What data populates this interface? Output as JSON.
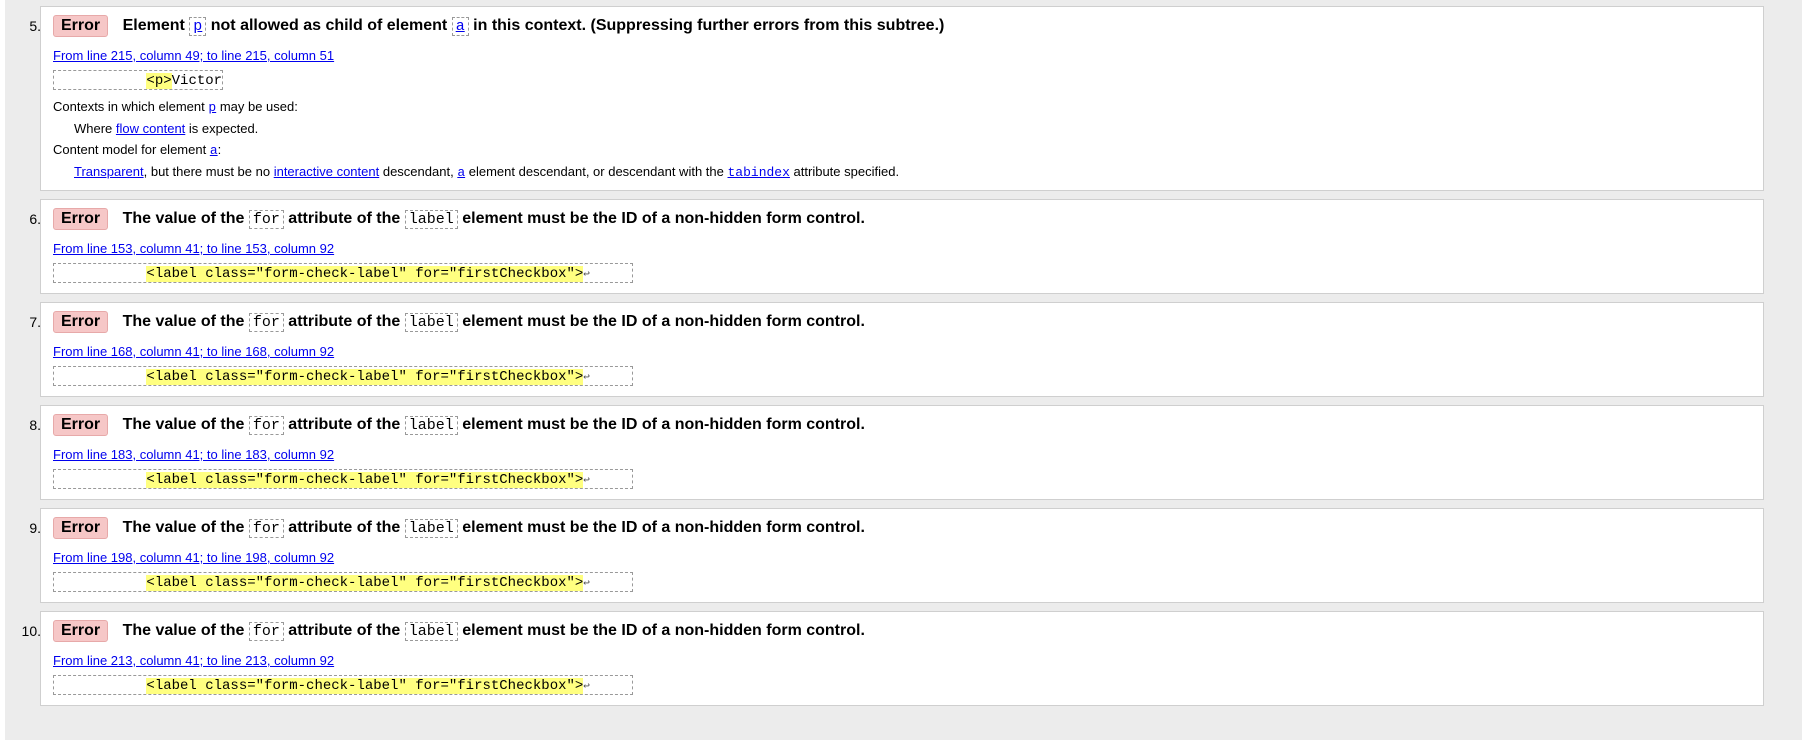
{
  "error_label": "Error",
  "linefeed": "↩",
  "items": [
    {
      "num": "5.",
      "msg": {
        "pre": "Element",
        "c1": "p",
        "mid": "not allowed as child of element",
        "c2": "a",
        "post": "in this context. (Suppressing further errors from this subtree.)"
      },
      "loc": "From line 215, column 49; to line 215, column 51",
      "extract": {
        "lead": "           ",
        "hl": "<p>",
        "rest": "Victor"
      },
      "contexts_label": "Contexts in which element",
      "contexts_el": "p",
      "contexts_suffix": "may be used:",
      "contexts_where": "Where",
      "contexts_link": "flow content",
      "contexts_end": "is expected.",
      "model_label": "Content model for element",
      "model_el": "a",
      "model_colon": ":",
      "model_link1": "Transparent",
      "model_t1": ", but there must be no",
      "model_link2": "interactive content",
      "model_t2": "descendant,",
      "model_link3": "a",
      "model_t3": "element descendant, or descendant with the",
      "model_link4": "tabindex",
      "model_t4": "attribute specified."
    },
    {
      "num": "6.",
      "msg": {
        "pre": "The value of the",
        "c1": "for",
        "mid": "attribute of the",
        "c2": "label",
        "post": "element must be the ID of a non-hidden form control."
      },
      "loc": "From line 153, column 41; to line 153, column 92",
      "extract": {
        "lead": "           ",
        "hl": "<label class=\"form-check-label\" for=\"firstCheckbox\">"
      }
    },
    {
      "num": "7.",
      "msg": {
        "pre": "The value of the",
        "c1": "for",
        "mid": "attribute of the",
        "c2": "label",
        "post": "element must be the ID of a non-hidden form control."
      },
      "loc": "From line 168, column 41; to line 168, column 92",
      "extract": {
        "lead": "           ",
        "hl": "<label class=\"form-check-label\" for=\"firstCheckbox\">"
      }
    },
    {
      "num": "8.",
      "msg": {
        "pre": "The value of the",
        "c1": "for",
        "mid": "attribute of the",
        "c2": "label",
        "post": "element must be the ID of a non-hidden form control."
      },
      "loc": "From line 183, column 41; to line 183, column 92",
      "extract": {
        "lead": "           ",
        "hl": "<label class=\"form-check-label\" for=\"firstCheckbox\">"
      }
    },
    {
      "num": "9.",
      "msg": {
        "pre": "The value of the",
        "c1": "for",
        "mid": "attribute of the",
        "c2": "label",
        "post": "element must be the ID of a non-hidden form control."
      },
      "loc": "From line 198, column 41; to line 198, column 92",
      "extract": {
        "lead": "           ",
        "hl": "<label class=\"form-check-label\" for=\"firstCheckbox\">"
      }
    },
    {
      "num": "10.",
      "msg": {
        "pre": "The value of the",
        "c1": "for",
        "mid": "attribute of the",
        "c2": "label",
        "post": "element must be the ID of a non-hidden form control."
      },
      "loc": "From line 213, column 41; to line 213, column 92",
      "extract": {
        "lead": "           ",
        "hl": "<label class=\"form-check-label\" for=\"firstCheckbox\">"
      }
    }
  ]
}
